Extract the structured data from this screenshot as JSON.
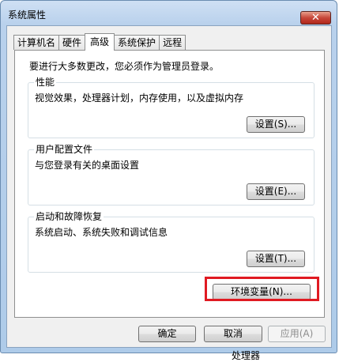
{
  "window": {
    "title": "系统属性",
    "close_glyph": "✕"
  },
  "tabs": [
    {
      "label": "计算机名"
    },
    {
      "label": "硬件"
    },
    {
      "label": "高级"
    },
    {
      "label": "系统保护"
    },
    {
      "label": "远程"
    }
  ],
  "panel": {
    "admin_note": "要进行大多数更改，您必须作为管理员登录。",
    "performance": {
      "title": "性能",
      "desc": "视觉效果，处理器计划，内存使用，以及虚拟内存",
      "button": "设置(S)..."
    },
    "profile": {
      "title": "用户配置文件",
      "desc": "与您登录有关的桌面设置",
      "button": "设置(E)..."
    },
    "startup": {
      "title": "启动和故障恢复",
      "desc": "系统启动、系统失败和调试信息",
      "button": "设置(T)..."
    },
    "env_button": "环境变量(N)..."
  },
  "footer": {
    "ok": "确定",
    "cancel": "取消",
    "apply": "应用(A)"
  },
  "background": {
    "partial_text": "处理器"
  },
  "colors": {
    "highlight": "#e01a22",
    "title_bar": "#b9d1ec",
    "close_button": "#c7473a"
  }
}
